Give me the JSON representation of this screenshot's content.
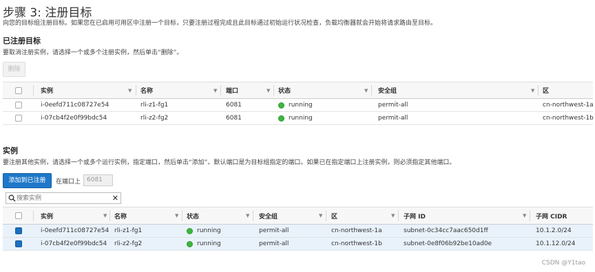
{
  "page": {
    "title": "步骤 3: 注册目标",
    "subtitle": "向您的目标组注册目标。如果您在已启用可用区中注册一个目标，只要注册过程完成且此目标通过初始运行状况检查，负载均衡器就会开始将请求路由至目标。"
  },
  "registered": {
    "heading": "已注册目标",
    "description": "要取消注册实例，请选择一个或多个注册实例，然后单击“删除”。",
    "delete_button": "删除",
    "columns": [
      "实例",
      "名称",
      "端口",
      "状态",
      "安全组",
      "区"
    ],
    "rows": [
      {
        "instance": "i-0eefd711c08727e54",
        "name": "rli-z1-fg1",
        "port": "6081",
        "status": "running",
        "sg": "permit-all",
        "zone": "cn-northwest-1a"
      },
      {
        "instance": "i-07cb4f2e0f99bdc54",
        "name": "rli-z2-fg2",
        "port": "6081",
        "status": "running",
        "sg": "permit-all",
        "zone": "cn-northwest-1b"
      }
    ]
  },
  "instances": {
    "heading": "实例",
    "description": "要注册其他实例，请选择一个或多个运行实例，指定端口，然后单击“添加”。默认端口是为目标组指定的端口。如果已在指定端口上注册实例，则必须指定其他端口。",
    "add_button": "添加到已注册",
    "port_label": "在端口上",
    "port_value": "6081",
    "search_placeholder": "搜索实例",
    "columns": [
      "实例",
      "名称",
      "状态",
      "安全组",
      "区",
      "子网 ID",
      "子网 CIDR"
    ],
    "rows": [
      {
        "instance": "i-0eefd711c08727e54",
        "name": "rli-z1-fg1",
        "status": "running",
        "sg": "permit-all",
        "zone": "cn-northwest-1a",
        "subnet": "subnet-0c34cc7aac650d1ff",
        "cidr": "10.1.2.0/24",
        "checked": true
      },
      {
        "instance": "i-07cb4f2e0f99bdc54",
        "name": "rli-z2-fg2",
        "status": "running",
        "sg": "permit-all",
        "zone": "cn-northwest-1b",
        "subnet": "subnet-0e8f06b92be10ad0e",
        "cidr": "10.1.12.0/24",
        "checked": true
      }
    ]
  },
  "watermark": "CSDN @Y1tao",
  "colors": {
    "primary": "#1f78c9",
    "running": "#3fb53f",
    "selected_row": "#e9f2fb"
  }
}
